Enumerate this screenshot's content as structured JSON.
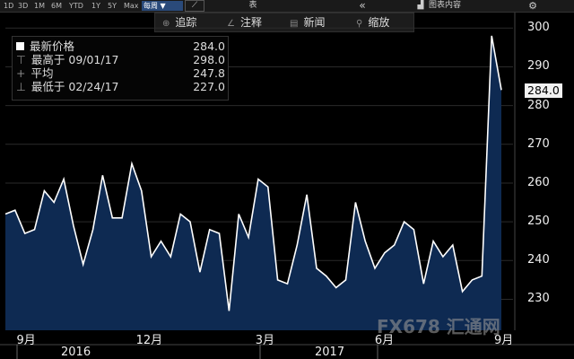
{
  "topbar": {
    "ranges": [
      "1D",
      "3D",
      "1M",
      "6M",
      "YTD",
      "1Y",
      "5Y",
      "Max"
    ],
    "frequency": "每周 ▼",
    "table_label": "表",
    "collapse_icon": "«",
    "chart_content_label": "图表内容",
    "settings_icon": "gear-icon"
  },
  "toolbar": {
    "track": "追踪",
    "annotate": "注释",
    "news": "新闻",
    "zoom": "缩放"
  },
  "legend": {
    "items": [
      {
        "label": "最新价格",
        "value": "284.0"
      },
      {
        "label": "最高于 09/01/17",
        "value": "298.0"
      },
      {
        "label": "平均",
        "value": "247.8"
      },
      {
        "label": "最低于 02/24/17",
        "value": "227.0"
      }
    ]
  },
  "last_value_badge": "284.0",
  "watermark": "FX678 汇通网",
  "chart_data": {
    "type": "area",
    "y_ticks": [
      "300",
      "290",
      "280",
      "270",
      "260",
      "250",
      "240",
      "230"
    ],
    "ylim": [
      222,
      304
    ],
    "x_month_labels": [
      "9月",
      "12月",
      "3月",
      "6月",
      "9月"
    ],
    "x_year_labels": [
      "2016",
      "2017"
    ],
    "values": [
      252,
      253,
      247,
      248,
      258,
      255,
      261,
      249,
      239,
      248,
      262,
      251,
      251,
      265,
      258,
      241,
      245,
      241,
      252,
      250,
      237,
      248,
      247,
      227,
      252,
      246,
      261,
      259,
      235,
      234,
      244,
      257,
      238,
      236,
      233,
      235,
      255,
      245,
      238,
      242,
      244,
      250,
      248,
      234,
      245,
      241,
      244,
      232,
      235,
      236,
      298,
      284
    ],
    "colors": {
      "line": "#ffffff",
      "fill": "#0e2a52",
      "grid": "#2a2a2a"
    }
  }
}
